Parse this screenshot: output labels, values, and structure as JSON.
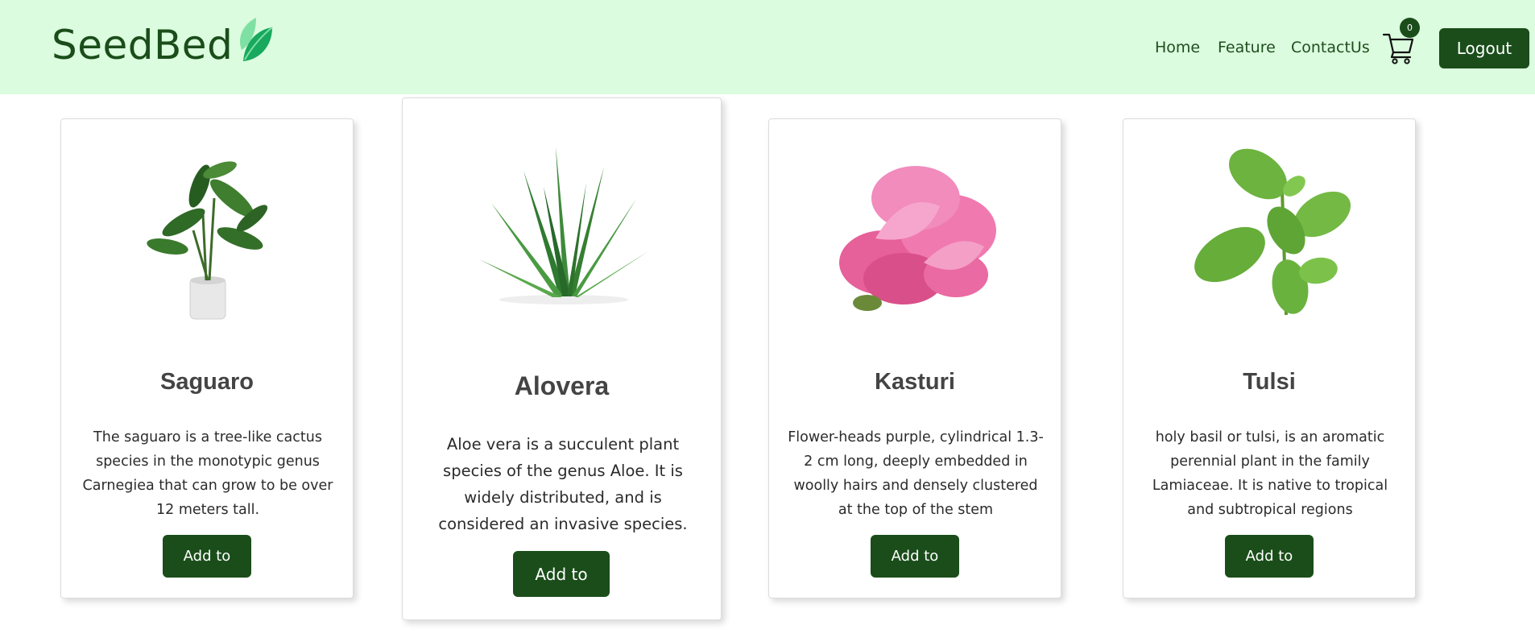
{
  "brand": {
    "name": "SeedBed"
  },
  "nav": {
    "home": "Home",
    "feature": "Feature",
    "contact": "ContactUs"
  },
  "cart": {
    "count": "0"
  },
  "logout_label": "Logout",
  "colors": {
    "navbar_bg": "#dbfcde",
    "primary": "#1a4d1a",
    "leaf_light": "#7fe0a4",
    "leaf_dark": "#18a85e"
  },
  "products": [
    {
      "name": "Saguaro",
      "image_icon": "potted-plant-icon",
      "description": "The saguaro is a tree-like cactus species in the monotypic genus Carnegiea that can grow to be over 12 meters tall.",
      "button": "Add to"
    },
    {
      "name": "Alovera",
      "image_icon": "aloe-vera-icon",
      "description": "Aloe vera is a succulent plant species of the genus Aloe. It is widely distributed, and is considered an invasive species.",
      "button": "Add to"
    },
    {
      "name": "Kasturi",
      "image_icon": "pink-flower-icon",
      "description": "Flower-heads purple, cylindrical 1.3-2 cm long, deeply embedded in woolly hairs and densely clustered at the top of the stem",
      "button": "Add to"
    },
    {
      "name": "Tulsi",
      "image_icon": "basil-leaves-icon",
      "description": "holy basil or tulsi, is an aromatic perennial plant in the family Lamiaceae. It is native to tropical and subtropical regions",
      "button": "Add to"
    }
  ]
}
